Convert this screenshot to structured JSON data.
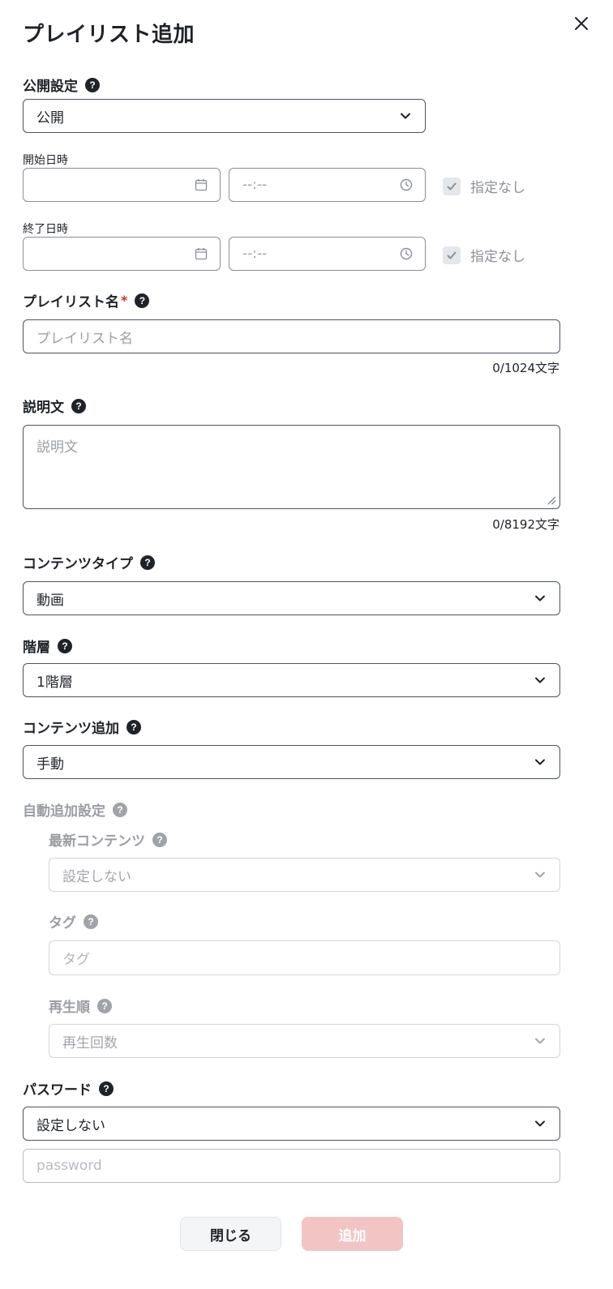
{
  "title": "プレイリスト追加",
  "visibility": {
    "label": "公開設定",
    "value": "公開"
  },
  "start": {
    "label": "開始日時",
    "time_placeholder": "--:--",
    "no_spec": "指定なし"
  },
  "end": {
    "label": "終了日時",
    "time_placeholder": "--:--",
    "no_spec": "指定なし"
  },
  "playlist_name": {
    "label": "プレイリスト名",
    "required_mark": "*",
    "placeholder": "プレイリスト名",
    "counter": "0/1024文字"
  },
  "description": {
    "label": "説明文",
    "placeholder": "説明文",
    "counter": "0/8192文字"
  },
  "content_type": {
    "label": "コンテンツタイプ",
    "value": "動画"
  },
  "hierarchy": {
    "label": "階層",
    "value": "1階層"
  },
  "content_add": {
    "label": "コンテンツ追加",
    "value": "手動"
  },
  "auto_add": {
    "label": "自動追加設定",
    "latest": {
      "label": "最新コンテンツ",
      "value": "設定しない"
    },
    "tag": {
      "label": "タグ",
      "placeholder": "タグ"
    },
    "order": {
      "label": "再生順",
      "value": "再生回数"
    }
  },
  "password": {
    "label": "パスワード",
    "value": "設定しない",
    "placeholder": "password"
  },
  "buttons": {
    "close": "閉じる",
    "add": "追加"
  },
  "help_glyph": "?",
  "colors": {
    "accent_disabled": "#f2c4c4",
    "required": "#d0312d",
    "border": "#4b5563"
  }
}
